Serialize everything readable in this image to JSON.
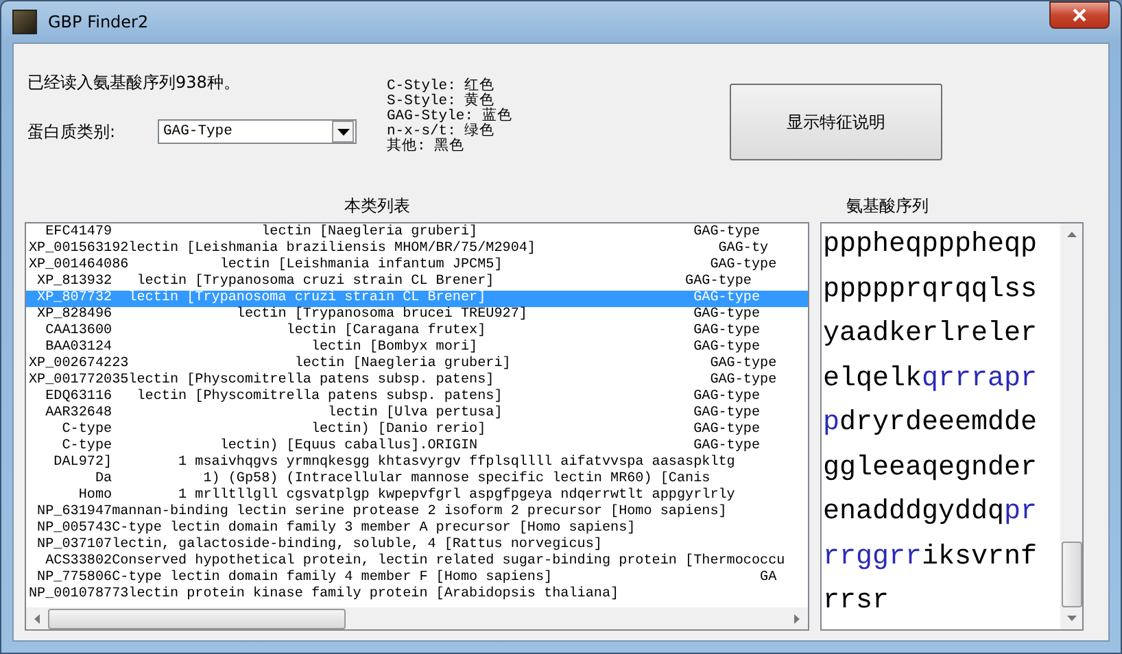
{
  "window": {
    "title": "GBP Finder2"
  },
  "status_text": "已经读入氨基酸序列938种。",
  "category": {
    "label": "蛋白质类别:",
    "value": "GAG-Type"
  },
  "legend": [
    "C-Style: 红色",
    "S-Style: 黄色",
    "GAG-Style: 蓝色",
    "n-x-s/t: 绿色",
    "其他: 黑色"
  ],
  "show_button": "显示特征说明",
  "list_title": "本类列表",
  "sequence_title": "氨基酸序列",
  "list_rows": [
    {
      "text": "  EFC41479                  lectin [Naegleria gruberi]                          GAG-type",
      "selected": false
    },
    {
      "text": "XP_001563192lectin [Leishmania braziliensis MHOM/BR/75/M2904]                      GAG-ty",
      "selected": false
    },
    {
      "text": "XP_001464086           lectin [Leishmania infantum JPCM5]                         GAG-type",
      "selected": false
    },
    {
      "text": " XP_813932   lectin [Trypanosoma cruzi strain CL Brener]                       GAG-type",
      "selected": false
    },
    {
      "text": " XP_807732  lectin [Trypanosoma cruzi strain CL Brener]                         GAG-type",
      "selected": true
    },
    {
      "text": " XP_828496               lectin [Trypanosoma brucei TREU927]                    GAG-type",
      "selected": false
    },
    {
      "text": "  CAA13600                     lectin [Caragana frutex]                         GAG-type",
      "selected": false
    },
    {
      "text": "  BAA03124                        lectin [Bombyx mori]                          GAG-type",
      "selected": false
    },
    {
      "text": "XP_002674223                    lectin [Naegleria gruberi]                        GAG-type",
      "selected": false
    },
    {
      "text": "XP_001772035lectin [Physcomitrella patens subsp. patens]                          GAG-type",
      "selected": false
    },
    {
      "text": "  EDQ63116   lectin [Physcomitrella patens subsp. patens]                       GAG-type",
      "selected": false
    },
    {
      "text": "  AAR32648                          lectin [Ulva pertusa]                       GAG-type",
      "selected": false
    },
    {
      "text": "    C-type                        lectin) [Danio rerio]                         GAG-type",
      "selected": false
    },
    {
      "text": "    C-type             lectin) [Equus caballus].ORIGIN                          GAG-type",
      "selected": false
    },
    {
      "text": "   DAL972]        1 msaivhqgvs yrmnqkesgg khtasvyrgv ffplsqllll aifatvvspa aasaspkltg",
      "selected": false
    },
    {
      "text": "        Da           1) (Gp58) (Intracellular mannose specific lectin MR60) [Canis",
      "selected": false
    },
    {
      "text": "      Homo        1 mrlltllgll cgsvatplgp kwpepvfgrl aspgfpgeya ndqerrwtlt appgyrlrly",
      "selected": false
    },
    {
      "text": " NP_631947mannan-binding lectin serine protease 2 isoform 2 precursor [Homo sapiens]",
      "selected": false
    },
    {
      "text": " NP_005743C-type lectin domain family 3 member A precursor [Homo sapiens]",
      "selected": false
    },
    {
      "text": " NP_037107lectin, galactoside-binding, soluble, 4 [Rattus norvegicus]",
      "selected": false
    },
    {
      "text": "  ACS33802Conserved hypothetical protein, lectin related sugar-binding protein [Thermococcu",
      "selected": false
    },
    {
      "text": " NP_775806C-type lectin domain family 4 member F [Homo sapiens]                         GA",
      "selected": false
    },
    {
      "text": "NP_001078773lectin protein kinase family protein [Arabidopsis thaliana]",
      "selected": false
    }
  ],
  "sequence_lines": [
    [
      {
        "text": "ppphеqppphеqp",
        "color": "#000000"
      }
    ],
    [
      {
        "text": "ppppprqrqqlss",
        "color": "#000000"
      }
    ],
    [
      {
        "text": "yaadkerlreler",
        "color": "#000000"
      }
    ],
    [
      {
        "text": "elqelk",
        "color": "#000000"
      },
      {
        "text": "qrrrapr",
        "color": "#2a2ab8"
      }
    ],
    [
      {
        "text": "p",
        "color": "#2a2ab8"
      },
      {
        "text": "dryrdeeemdde",
        "color": "#000000"
      }
    ],
    [
      {
        "text": "ggleeaqegnder",
        "color": "#000000"
      }
    ],
    [
      {
        "text": "enadddgyddq",
        "color": "#000000"
      },
      {
        "text": "pr",
        "color": "#2a2ab8"
      }
    ],
    [
      {
        "text": "rrggrr",
        "color": "#2a2ab8"
      },
      {
        "text": "iksvrnf",
        "color": "#000000"
      }
    ],
    [
      {
        "text": "rrsr",
        "color": "#000000"
      }
    ]
  ]
}
